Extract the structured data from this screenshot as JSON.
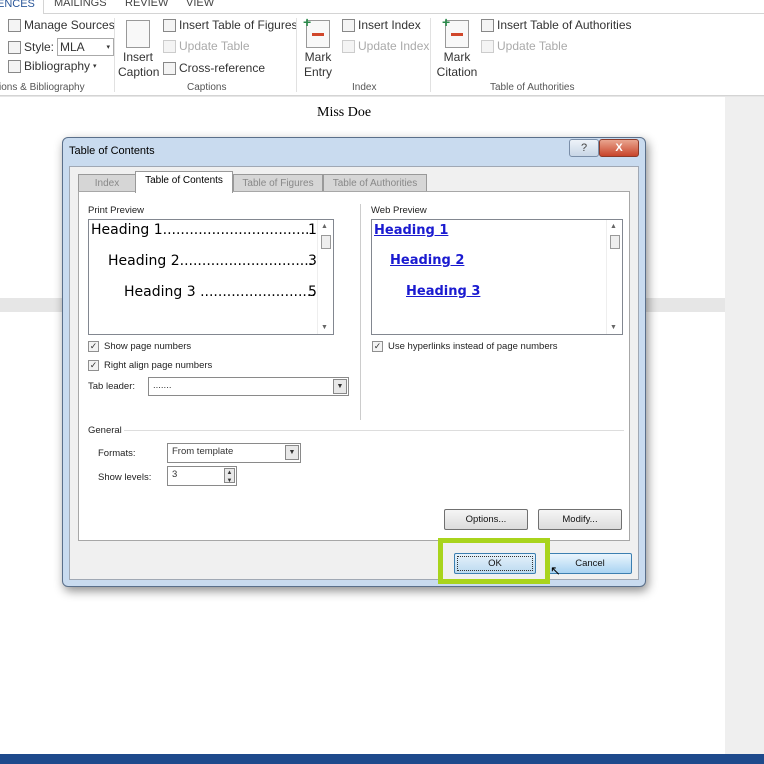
{
  "ribbon_tabs": [
    "ENCES",
    "MAILINGS",
    "REVIEW",
    "VIEW"
  ],
  "ribbon": {
    "citations": {
      "manage_sources": "Manage Sources",
      "style_label": "Style:",
      "style_value": "MLA",
      "bibliography": "Bibliography",
      "group": "ions & Bibliography"
    },
    "captions": {
      "insert_caption": "Insert Caption",
      "insert_tof": "Insert Table of Figures",
      "update_table": "Update Table",
      "cross_reference": "Cross-reference",
      "group": "Captions"
    },
    "index": {
      "mark_entry": "Mark Entry",
      "insert_index": "Insert Index",
      "update_index": "Update Index",
      "group": "Index"
    },
    "toa": {
      "mark_citation": "Mark Citation",
      "insert_toa": "Insert Table of Authorities",
      "update_table": "Update Table",
      "group": "Table of Authorities"
    }
  },
  "document": {
    "author": "Miss Doe"
  },
  "dialog": {
    "title": "Table of Contents",
    "help": "?",
    "close": "X",
    "tabs": [
      "Index",
      "Table of Contents",
      "Table of Figures",
      "Table of Authorities"
    ],
    "active_tab": "Table of Contents",
    "print_preview": {
      "label": "Print Preview",
      "entries": [
        {
          "text": "Heading 1.................................",
          "page": "1"
        },
        {
          "text": "Heading 2..............................",
          "page": "3"
        },
        {
          "text": "Heading 3 ..........................",
          "page": "5"
        }
      ]
    },
    "web_preview": {
      "label": "Web Preview",
      "entries": [
        "Heading 1",
        "Heading 2",
        "Heading 3"
      ]
    },
    "show_page_numbers": {
      "label": "Show page numbers",
      "checked": true
    },
    "right_align": {
      "label": "Right align page numbers",
      "checked": true
    },
    "use_hyperlinks": {
      "label": "Use hyperlinks instead of page numbers",
      "checked": true
    },
    "tab_leader": {
      "label": "Tab leader:",
      "value": "......."
    },
    "general": {
      "label": "General",
      "formats_label": "Formats:",
      "formats_value": "From template",
      "levels_label": "Show levels:",
      "levels_value": "3"
    },
    "buttons": {
      "options": "Options...",
      "modify": "Modify...",
      "ok": "OK",
      "cancel": "Cancel"
    },
    "highlight_color": "#a9d41c"
  },
  "colors": {
    "statusbar": "#1e4a8c",
    "accent": "#2b579a",
    "link": "#1a1ad0"
  }
}
